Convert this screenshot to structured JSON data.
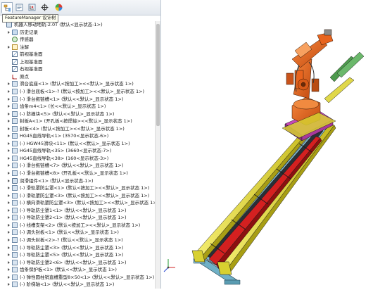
{
  "tooltip": "FeatureManager 设计树",
  "tabs": [
    {
      "icon": "feature-manager-icon"
    },
    {
      "icon": "property-manager-icon"
    },
    {
      "icon": "configuration-manager-icon"
    },
    {
      "icon": "dimxpert-icon"
    },
    {
      "icon": "display-manager-icon"
    }
  ],
  "tree": [
    {
      "label": "机器人移动地轨-2.0T  (默认<显示状态-1>)",
      "icon": "assembly-icon",
      "indent": 0,
      "expandable": false
    },
    {
      "label": "历史记录",
      "icon": "history-icon",
      "indent": 1,
      "expandable": true
    },
    {
      "label": "传感器",
      "icon": "sensor-icon",
      "indent": 1,
      "expandable": false
    },
    {
      "label": "注解",
      "icon": "annotation-icon",
      "indent": 1,
      "expandable": true
    },
    {
      "label": "前视基准面",
      "icon": "plane-icon",
      "indent": 1,
      "expandable": false
    },
    {
      "label": "上视基准面",
      "icon": "plane-icon",
      "indent": 1,
      "expandable": false
    },
    {
      "label": "右视基准面",
      "icon": "plane-icon",
      "indent": 1,
      "expandable": false
    },
    {
      "label": "原点",
      "icon": "origin-icon",
      "indent": 1,
      "expandable": false
    },
    {
      "label": "滑台底座<1> (默认<按加工><<默认>_显示状态 1>)",
      "icon": "part-icon",
      "indent": 1,
      "expandable": true
    },
    {
      "label": "(-) 滑台底板<1>-? (默认<按加工><<默认>_显示状态 1>)",
      "icon": "part-icon",
      "indent": 1,
      "expandable": true
    },
    {
      "label": "(-) 滑台拖链槽<1> (默认<<默认>_显示状态 1>)",
      "icon": "part-icon",
      "indent": 1,
      "expandable": true
    },
    {
      "label": "齿条m4<1> (长<<默认>_显示状态 1>)",
      "icon": "part-icon",
      "indent": 1,
      "expandable": true
    },
    {
      "label": "(-) 防撞块<5> (默认<<默认>_显示状态 1>)",
      "icon": "part-icon",
      "indent": 1,
      "expandable": true
    },
    {
      "label": "封板A<1> (开孔板<按焊接><<默认>_显示状态 1>)",
      "icon": "part-icon",
      "indent": 1,
      "expandable": true
    },
    {
      "label": "封板<4> (默认<按加工><<默认>_显示状态 1>)",
      "icon": "part-icon",
      "indent": 1,
      "expandable": true
    },
    {
      "label": "HG45直线导轨<1> (3570<显示状态-6>)",
      "icon": "part-icon",
      "indent": 1,
      "expandable": true
    },
    {
      "label": "(-) HGW45滑块<11> (默认<<默认>_显示状态 1>)",
      "icon": "part-icon",
      "indent": 1,
      "expandable": true
    },
    {
      "label": "HG45直线导轨<35> (3660<显示状态-7>)",
      "icon": "part-icon",
      "indent": 1,
      "expandable": true
    },
    {
      "label": "HG45直线导轨<38> (160<显示状态-3>)",
      "icon": "part-icon",
      "indent": 1,
      "expandable": true
    },
    {
      "label": "(-) 滑台拖链槽<7> (默认<<默认>_显示状态 1>)",
      "icon": "part-icon",
      "indent": 1,
      "expandable": true
    },
    {
      "label": "(-) 滑台拖链槽<8> (开孔板<<默认>_显示状态 1>)",
      "icon": "part-icon",
      "indent": 1,
      "expandable": true
    },
    {
      "label": "润滑组件<1> (默认<显示状态-1>)",
      "icon": "assembly-icon",
      "indent": 1,
      "expandable": true
    },
    {
      "label": "(-) 滑轨罩防尘罩<1> (默认<按加工><<默认>_显示状态 1>)",
      "icon": "part-icon",
      "indent": 1,
      "expandable": true
    },
    {
      "label": "(-) 滑轨罩防尘罩<3> (默认<按加工><<默认>_显示状态 1>)",
      "icon": "part-icon",
      "indent": 1,
      "expandable": true
    },
    {
      "label": "(-) 横向滑轨罩防尘罩<3> (默认<按加工><<默认>_显示状态 1>)",
      "icon": "part-icon",
      "indent": 1,
      "expandable": true
    },
    {
      "label": "(-) 导轨防尘罩1<1> (默认<<默认>_显示状态 1>)",
      "icon": "part-icon",
      "indent": 1,
      "expandable": true
    },
    {
      "label": "(-) 导轨防尘罩2<1> (默认<<默认>_显示状态 1>)",
      "icon": "part-icon",
      "indent": 1,
      "expandable": true
    },
    {
      "label": "(-) 线槽支架<2> (默认<按加工><<默认>_显示状态 1>)",
      "icon": "part-icon",
      "indent": 1,
      "expandable": true
    },
    {
      "label": "(-) 调头封板<1> (默认<<默认>_显示状态 1>)",
      "icon": "part-icon",
      "indent": 1,
      "expandable": true
    },
    {
      "label": "(-) 调头封板<2>-? (默认<<默认>_显示状态 1>)",
      "icon": "part-icon",
      "indent": 1,
      "expandable": true
    },
    {
      "label": "(-) 导轨防尘罩<3> (默认<<默认>_显示状态 1>)",
      "icon": "part-icon",
      "indent": 1,
      "expandable": true
    },
    {
      "label": "(-) 导轨防尘罩<5> (默认<<默认>_显示状态 1>)",
      "icon": "part-icon",
      "indent": 1,
      "expandable": true
    },
    {
      "label": "(-) 导轨防尘罩2<6> (默认<<默认>_显示状态 1>)",
      "icon": "part-icon",
      "indent": 1,
      "expandable": true
    },
    {
      "label": "齿条保护板<1> (默认<<默认>_显示状态 1>)",
      "icon": "part-icon",
      "indent": 1,
      "expandable": true
    },
    {
      "label": "(-) 弹性圆柱销直槽重型8×50<1> (默认<<默认>_显示状态 1>)",
      "icon": "part-icon",
      "indent": 1,
      "expandable": true
    },
    {
      "label": "(-) 阶梯轴<1> (默认<<默认>_显示状态 1>)",
      "icon": "part-icon",
      "indent": 1,
      "expandable": true
    },
    {
      "label": "限位块<1> (默认<按加工><<默认>_显示状态 1>)",
      "icon": "part-icon",
      "indent": 1,
      "expandable": true
    }
  ],
  "scroll": {
    "position": 0.0,
    "visible_fraction": 0.39
  },
  "colors": {
    "robot_orange": "#e8641e",
    "robot_magenta": "#c648b8",
    "rail_yellow": "#e8dc3a",
    "rack_red": "#d42020",
    "base_teal": "#7fbcd0"
  }
}
